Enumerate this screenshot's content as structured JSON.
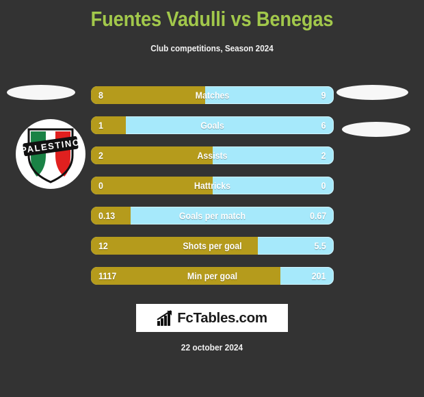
{
  "header": {
    "title": "Fuentes Vadulli vs Benegas",
    "subtitle": "Club competitions, Season 2024",
    "title_color": "#a2c84b",
    "background_color": "#333333"
  },
  "crest": {
    "club_name": "PALESTINO",
    "colors": {
      "green": "#1a8245",
      "white": "#ffffff",
      "red": "#e0201f",
      "banner": "#111111",
      "ring": "#ffffff"
    }
  },
  "stats": {
    "home_color": "#b59b1c",
    "away_color": "#a6e9fb",
    "rows": [
      {
        "label": "Matches",
        "home": "8",
        "away": "9",
        "home_pct": 47.0
      },
      {
        "label": "Goals",
        "home": "1",
        "away": "6",
        "home_pct": 14.3
      },
      {
        "label": "Assists",
        "home": "2",
        "away": "2",
        "home_pct": 50.0
      },
      {
        "label": "Hattricks",
        "home": "0",
        "away": "0",
        "home_pct": 50.0
      },
      {
        "label": "Goals per match",
        "home": "0.13",
        "away": "0.67",
        "home_pct": 16.3
      },
      {
        "label": "Shots per goal",
        "home": "12",
        "away": "5.5",
        "home_pct": 68.6
      },
      {
        "label": "Min per goal",
        "home": "1117",
        "away": "201",
        "home_pct": 78.0
      }
    ]
  },
  "footer": {
    "logo_text": "FcTables.com",
    "date": "22 october 2024"
  }
}
